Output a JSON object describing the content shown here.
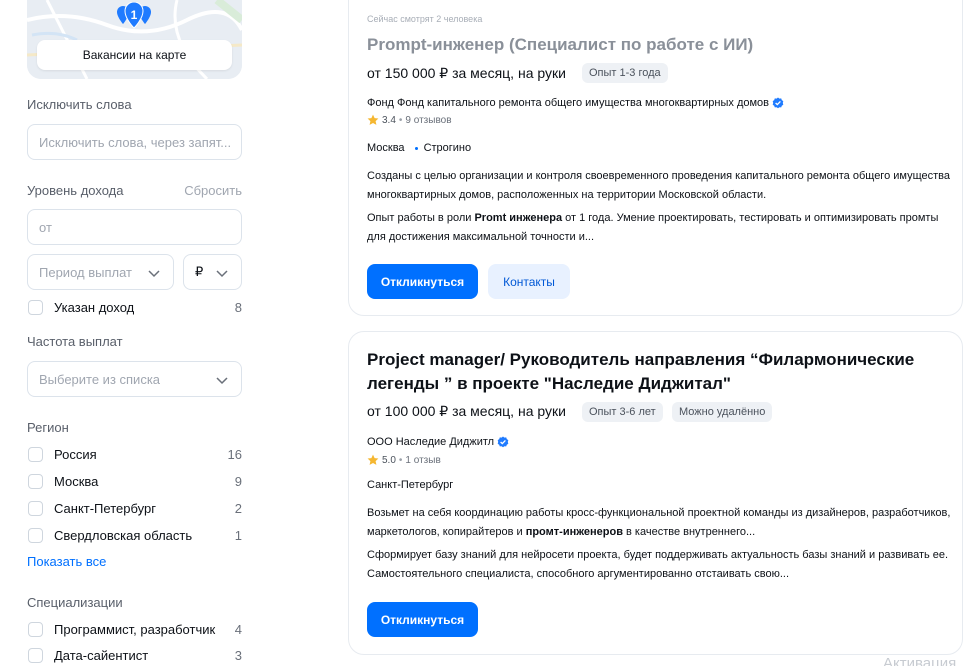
{
  "sidebar": {
    "map": {
      "button_label": "Вакансии на карте",
      "pin_count": "1"
    },
    "exclude_words": {
      "label": "Исключить слова",
      "placeholder": "Исключить слова, через запят..."
    },
    "income": {
      "label": "Уровень дохода",
      "reset": "Сбросить",
      "from_placeholder": "от",
      "period_placeholder": "Период выплат",
      "currency": "₽",
      "checkbox_label": "Указан доход",
      "checkbox_count": "8"
    },
    "frequency": {
      "label": "Частота выплат",
      "placeholder": "Выберите из списка"
    },
    "region": {
      "label": "Регион",
      "items": [
        {
          "label": "Россия",
          "count": "16"
        },
        {
          "label": "Москва",
          "count": "9"
        },
        {
          "label": "Санкт-Петербург",
          "count": "2"
        },
        {
          "label": "Свердловская область",
          "count": "1"
        }
      ],
      "show_all": "Показать все"
    },
    "specializations": {
      "label": "Специализации",
      "items": [
        {
          "label": "Программист, разработчик",
          "count": "4"
        },
        {
          "label": "Дата-сайентист",
          "count": "3"
        }
      ]
    }
  },
  "vacancies": [
    {
      "viewers": "Сейчас смотрят 2 человека",
      "title": "Prompt-инженер (Специалист по работе с ИИ)",
      "salary": "от 150 000 ₽ за месяц, на руки",
      "tags": [
        "Опыт 1-3 года"
      ],
      "company": "Фонд Фонд капитального ремонта общего имущества многоквартирных домов",
      "rating": "3.4",
      "reviews": "9 отзывов",
      "city": "Москва",
      "metro": "Строгино",
      "desc1": "Созданы с целью организации и контроля своевременного проведения капитального ремонта общего имущества многоквартирных домов, расположенных на территории Московской области.",
      "desc2_before": "Опыт работы в роли ",
      "desc2_bold": "Promt инженера",
      "desc2_after": " от 1 года. Умение проектировать, тестировать и оптимизировать промты для достижения максимальной точности и...",
      "apply_label": "Откликнуться",
      "contacts_label": "Контакты"
    },
    {
      "title": "Project manager/ Руководитель направления “Филармонические легенды ” в проекте \"Наследие Диджитал\"",
      "salary": "от 100 000 ₽ за месяц, на руки",
      "tags": [
        "Опыт 3-6 лет",
        "Можно удалённо"
      ],
      "company": "ООО Наследие Диджитл",
      "rating": "5.0",
      "reviews": "1 отзыв",
      "city": "Санкт-Петербург",
      "desc1_before": "Возьмет на себя координацию работы кросс-функциональной проектной команды из дизайнеров, разработчиков, маркетологов, копирайтеров и ",
      "desc1_bold": "промт-инженеров",
      "desc1_after": " в качестве внутреннего...",
      "desc2": "Сформирует базу знаний для нейросети проекта, будет поддерживать актуальность базы знаний и развивать ее. Самостоятельного специалиста, способного аргументированно отстаивать свою...",
      "apply_label": "Откликнуться"
    }
  ],
  "watermark": "Активация",
  "colors": {
    "accent": "#0070ff",
    "accent_soft": "#e8f1ff",
    "rating_star": "#f5b731",
    "verified": "#1f7bff"
  }
}
